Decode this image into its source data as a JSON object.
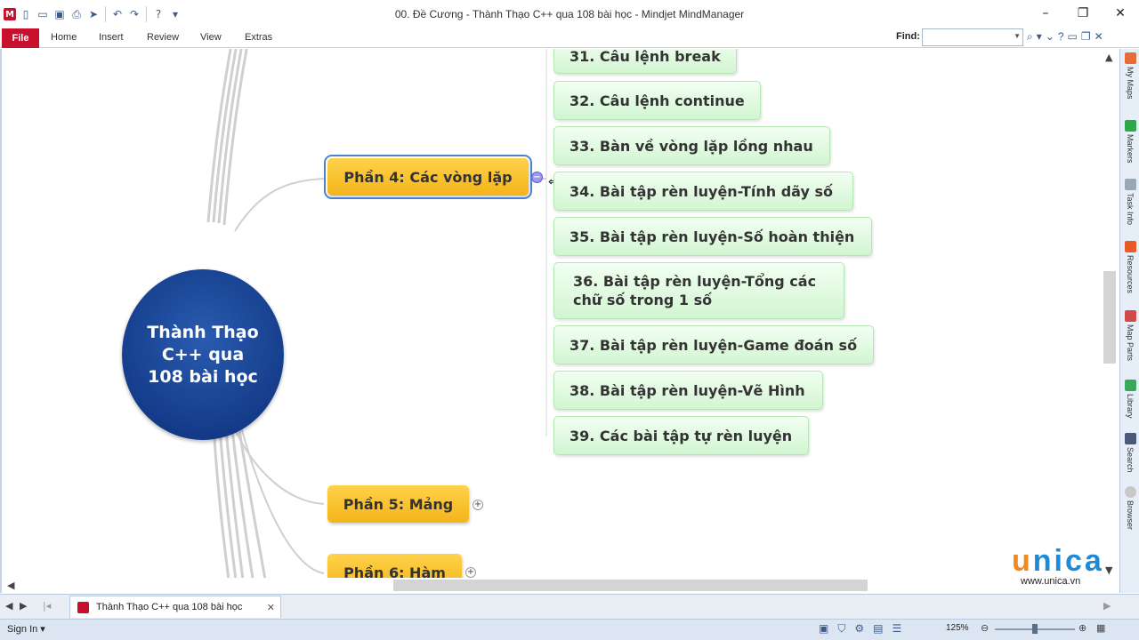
{
  "window": {
    "title": "00. Đề Cương - Thành Thạo C++ qua 108 bài học - Mindjet MindManager"
  },
  "ribbon": {
    "file_label": "File",
    "tabs": [
      "Home",
      "Insert",
      "Review",
      "View",
      "Extras"
    ],
    "find_label": "Find:",
    "find_value": ""
  },
  "map": {
    "central_topic": "Thành Thạo\nC++ qua\n108 bài học",
    "topics": [
      {
        "label": "Phần 4: Các vòng lặp",
        "selected": true,
        "expanded": true
      },
      {
        "label": "Phần 5: Mảng",
        "expanded": false
      },
      {
        "label": "Phần 6: Hàm",
        "expanded": false
      }
    ],
    "subtopics": [
      "31. Câu lệnh break",
      "32. Câu lệnh continue",
      "33. Bàn về vòng lặp lồng nhau",
      "34. Bài tập rèn luyện-Tính dãy số",
      "35. Bài tập rèn luyện-Số hoàn thiện",
      "36. Bài tập rèn luyện-Tổng các\nchữ số trong 1 số",
      "37. Bài tập rèn luyện-Game đoán số",
      "38. Bài tập rèn luyện-Vẽ Hình",
      "39. Các bài tập tự rèn luyện"
    ]
  },
  "side_panel": {
    "tabs": [
      "My Maps",
      "Markers",
      "Task Info",
      "Resources",
      "Map Parts",
      "Library",
      "Search",
      "Browser"
    ]
  },
  "document_tab": {
    "label": "Thành Thạo C++ qua 108 bài học"
  },
  "status": {
    "sign_in": "Sign In",
    "zoom": "125%"
  },
  "watermark": {
    "logo": "unica",
    "url": "www.unica.vn"
  },
  "colors": {
    "file_tab": "#c8102e",
    "topic": "#f4b41a",
    "subtopic": "#d2f5d2",
    "central": "#0b2f7a"
  }
}
